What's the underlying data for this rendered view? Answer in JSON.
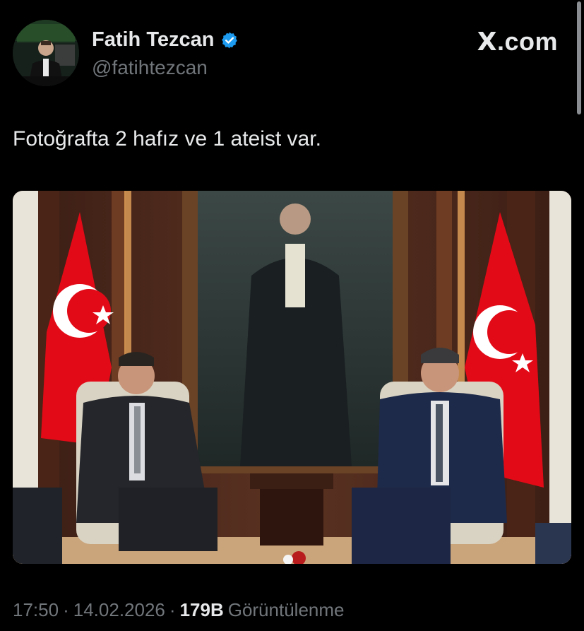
{
  "author": {
    "display_name": "Fatih Tezcan",
    "handle": "@fatihtezcan",
    "verified": true,
    "verified_badge_color": "#1d9bf0"
  },
  "brand": {
    "prefix": "X",
    "suffix": ".com"
  },
  "tweet": {
    "text": "Fotoğrafta 2 hafız ve 1 ateist var."
  },
  "photo": {
    "semantic": "photo-two-officials-seated-flags-portrait"
  },
  "meta": {
    "time": "17:50",
    "sep1": "·",
    "date": "14.02.2026",
    "sep2": "·",
    "views_count": "179B",
    "views_label": "Görüntülenme"
  },
  "colors": {
    "background": "#000000",
    "text_primary": "#e7e9ea",
    "text_secondary": "#71767b",
    "flag_red": "#e30a17"
  }
}
